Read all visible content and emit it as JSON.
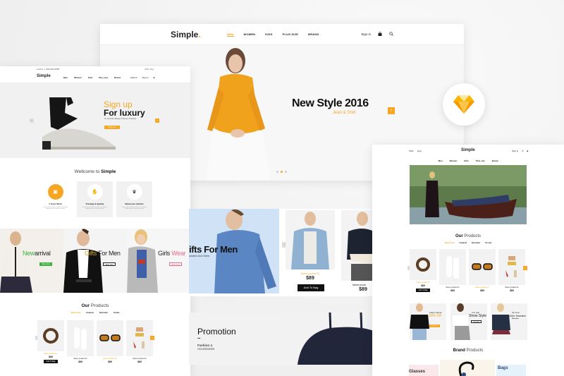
{
  "colors": {
    "accent": "#f5a623",
    "dark": "#111111",
    "bg": "#f4f4f4"
  },
  "main_panel": {
    "logo": "Simple",
    "logo_dot": ".",
    "menu": [
      {
        "label": "MEN",
        "active": true
      },
      {
        "label": "WOMEN"
      },
      {
        "label": "KIDS"
      },
      {
        "label": "PLUS SIZE"
      },
      {
        "label": "BRAND"
      }
    ],
    "sign_in": "Sign in",
    "cart_icon": "bag-icon",
    "search_icon": "search-icon",
    "hero": {
      "headline": "New Style 2016",
      "subline": "Jean & Shirt",
      "next_arrow": "›"
    }
  },
  "left_panel": {
    "topbar_left": "Hotline: 1-888-888-8888",
    "topbar_right": [
      "USD",
      "Eng"
    ],
    "logo": "Simple",
    "menu": [
      "Men",
      "Women",
      "Kids",
      "Plus size",
      "Brand"
    ],
    "right": [
      "Search",
      "Sign in"
    ],
    "hero": {
      "line1": "Sign up",
      "line2": "For luxury",
      "tagline": "An exclusive Range of Women Footwear",
      "button": "Shop Now",
      "prev_arrow": "‹",
      "next_arrow": "›"
    },
    "welcome": {
      "prefix": "Wellcome to ",
      "brand": "Simple"
    },
    "features": [
      {
        "title": "4 Years Work",
        "desc": "Lorem ipsum dolor sit amet consectetur adipiscing elit sed do eiusmod",
        "icon": "calendar-icon",
        "symbol": "▣"
      },
      {
        "title": "Prestige & Quality",
        "desc": "Lorem ipsum dolor sit amet consectetur adipiscing elit sed do eiusmod",
        "icon": "thumbs-up-icon",
        "symbol": "👍"
      },
      {
        "title": "Numerous Awards",
        "desc": "Lorem ipsum dolor sit amet consectetur adipiscing elit sed do eiusmod",
        "icon": "trophy-icon",
        "symbol": "🏆"
      }
    ],
    "banners": [
      {
        "title_a": "New",
        "title_b": "arrival",
        "sub": "Women Collection",
        "button": "Shop Now"
      },
      {
        "title_a": "Gifts",
        "title_b": " For Men",
        "sub": "Sweaters And Shirts",
        "button": "Shop Now"
      },
      {
        "title_a": "Girls",
        "title_b": " Wear",
        "sub": "New Collection",
        "button": "Shop Now"
      }
    ],
    "our_products": {
      "prefix": "Our",
      "suffix": " Products"
    },
    "tabs": [
      "New Arrival",
      "Featured",
      "Bestseller",
      "Onsale"
    ],
    "products": [
      {
        "name": "Name product 01",
        "price": "$89",
        "highlight": true,
        "button": "Add To Bag"
      },
      {
        "name": "Name product 01",
        "price": "$89"
      },
      {
        "name": "Name product 01",
        "price": "$89",
        "highlight": true
      },
      {
        "name": "Name product 01",
        "price": "$89"
      }
    ]
  },
  "gifts_panel": {
    "title": "ifts For Men",
    "sub": "weaters And Shirts",
    "prev_arrow": "‹",
    "products": [
      {
        "name": "Name product 01",
        "price": "$89",
        "button": "Add To Bag"
      },
      {
        "name": "Name produ",
        "price": "$89"
      }
    ]
  },
  "promo_panel": {
    "title": "Promotion",
    "dash": "–",
    "sub_a": "Fashion",
    "sub_b": " &",
    "sub_c": "Accessories"
  },
  "right_panel": {
    "top_left": [
      "USD",
      "Eng"
    ],
    "logo": "Simple",
    "top_right": [
      "Sign in"
    ],
    "menu": [
      "Men",
      "Women",
      "Kids",
      "Plus size",
      "Brand"
    ],
    "our_products": {
      "prefix": "Our",
      "suffix": " Products"
    },
    "tabs": [
      "New Arrival",
      "Featured",
      "Bestseller",
      "On sale"
    ],
    "products": [
      {
        "name": "Name product 01",
        "price": "$89",
        "highlight": true,
        "button": "Add To Bag"
      },
      {
        "name": "Name product 01",
        "price": "$89"
      },
      {
        "name": "Name product 01",
        "price": "$89",
        "highlight": true
      },
      {
        "name": "Name product 01",
        "price": "$89"
      }
    ],
    "promos": [
      {
        "line1": "Today's Special",
        "line2": "20% Off",
        "button": "Shop Now"
      },
      {
        "line1": "Your style",
        "line2": "Show Style",
        "button": "Shop Now"
      },
      {
        "line1": "Top Level",
        "line2": "Girls Sweater",
        "button": "Shop Now"
      }
    ],
    "brand_products": {
      "prefix": "Brand",
      "suffix": " Products"
    },
    "brands": [
      "Glasses",
      "Bags"
    ]
  },
  "sketch_badge": {
    "icon": "sketch-diamond-icon"
  }
}
